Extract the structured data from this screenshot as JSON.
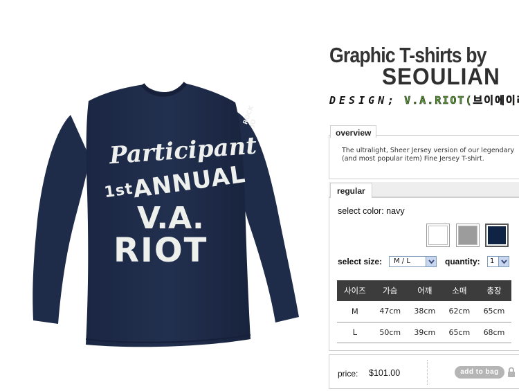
{
  "brand": {
    "title_line1": "Graphic T-shirts by",
    "title_line2": "SEOULIAN",
    "design_label": "DESIGN;",
    "design_name": "V.A.RIOT(브이에이라"
  },
  "product_image": {
    "print_line1": "Participant",
    "print_line2_sup": "1st",
    "print_line2": "ANNUAL",
    "print_line3": "V.A.",
    "print_line4": "RIOT",
    "sleeve_print": "ROCK\nJO",
    "shirt_color": "#1e2b49",
    "print_color": "#eef0ee"
  },
  "overview": {
    "tab_label": "overview",
    "text": "The ultralight, Sheer Jersey version of our legendary (and most popular item) Fine Jersey T-shirt."
  },
  "options": {
    "tab_label": "regular",
    "select_color_label": "select color: navy",
    "swatches": [
      {
        "name": "white",
        "color": "#ffffff"
      },
      {
        "name": "grey",
        "color": "#9c9c9c"
      },
      {
        "name": "navy",
        "color": "#0f2345"
      }
    ],
    "select_size_label": "select  size:",
    "size_value": "M / L",
    "quantity_label": "quantity:",
    "quantity_value": "1"
  },
  "size_table": {
    "headers": [
      "사이즈",
      "가슴",
      "어깨",
      "소매",
      "총장"
    ],
    "rows": [
      [
        "M",
        "47cm",
        "38cm",
        "62cm",
        "65cm"
      ],
      [
        "L",
        "50cm",
        "39cm",
        "65cm",
        "68cm"
      ]
    ]
  },
  "purchase": {
    "price_label": "price:",
    "price_value": "$101.00",
    "add_to_bag_label": "add to bag"
  }
}
